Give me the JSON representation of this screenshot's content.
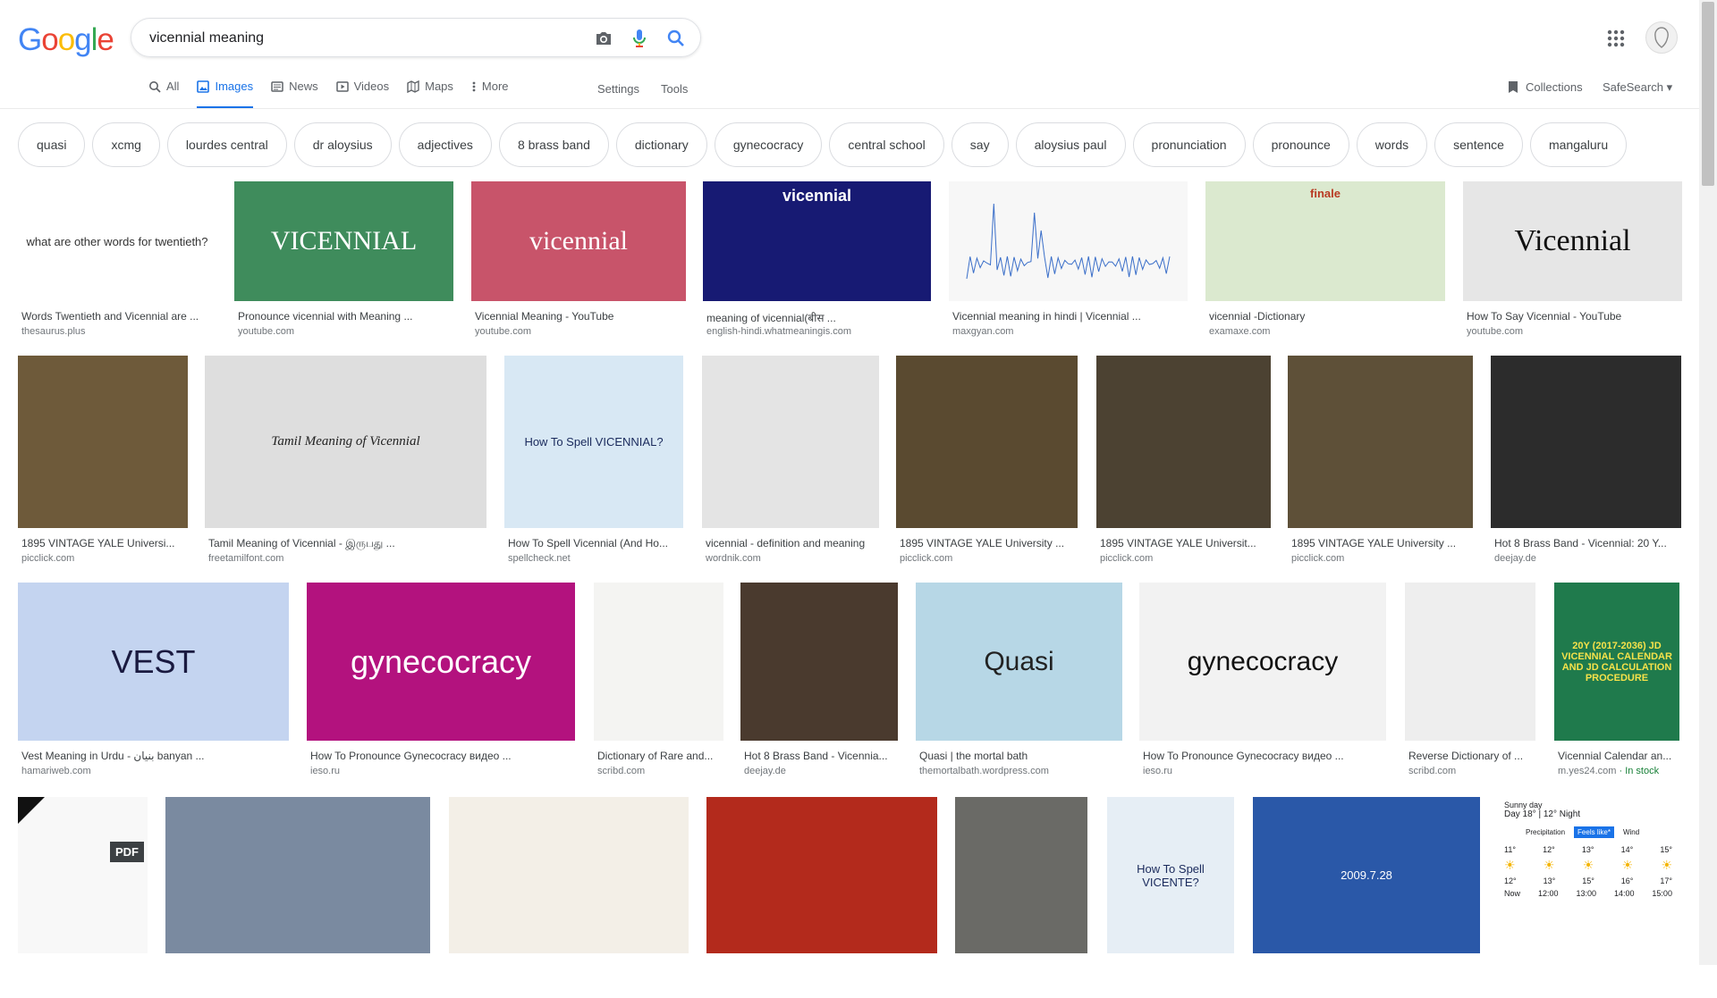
{
  "header": {
    "logo": "Google",
    "search_value": "vicennial meaning"
  },
  "tabs": [
    {
      "label": "All",
      "icon": "search-icon"
    },
    {
      "label": "Images",
      "icon": "image-icon",
      "active": true
    },
    {
      "label": "News",
      "icon": "news-icon"
    },
    {
      "label": "Videos",
      "icon": "video-icon"
    },
    {
      "label": "Maps",
      "icon": "map-icon"
    },
    {
      "label": "More",
      "icon": "more-vert-icon"
    }
  ],
  "settings_label": "Settings",
  "tools_label": "Tools",
  "collections_label": "Collections",
  "safesearch_label": "SafeSearch",
  "chips": [
    "quasi",
    "xcmg",
    "lourdes central",
    "dr aloysius",
    "adjectives",
    "8 brass band",
    "dictionary",
    "gynecocracy",
    "central school",
    "say",
    "aloysius paul",
    "pronunciation",
    "pronounce",
    "words",
    "sentence",
    "mangaluru"
  ],
  "results": [
    {
      "title": "Words Twentieth and Vicennial are ...",
      "source": "thesaurus.plus",
      "thumb_text": "what are other words for twentieth?",
      "bg": "#ffffff",
      "fg": "#333333"
    },
    {
      "title": "Pronounce vicennial with Meaning ...",
      "source": "youtube.com",
      "thumb_text": "VICENNIAL",
      "bg": "#3f8c5c",
      "fg": "#ffffff"
    },
    {
      "title": "Vicennial Meaning - YouTube",
      "source": "youtube.com",
      "thumb_text": "vicennial",
      "bg": "#c8546a",
      "fg": "#ffffff"
    },
    {
      "title": "meaning of vicennial(बीस ...",
      "source": "english-hindi.whatmeaningis.com",
      "thumb_text": "vicennial",
      "bg": "#171a73",
      "fg": "#ffffff"
    },
    {
      "title": "Vicennial meaning in hindi | Vicennial ...",
      "source": "maxgyan.com",
      "thumb_text": "",
      "bg": "#f7f7f7",
      "fg": "#3b6fc9"
    },
    {
      "title": "vicennial -Dictionary",
      "source": "examaxe.com",
      "thumb_text": "finale",
      "bg": "#dbe9cf",
      "fg": "#b83a22"
    },
    {
      "title": "How To Say Vicennial - YouTube",
      "source": "youtube.com",
      "thumb_text": "Vicennial",
      "bg": "#e6e6e6",
      "fg": "#111111"
    },
    {
      "title": "1895 VINTAGE YALE Universi...",
      "source": "picclick.com",
      "thumb_text": "",
      "bg": "#6e5a3a",
      "fg": "#e8e2c8"
    },
    {
      "title": "Tamil Meaning of Vicennial - இருபது ...",
      "source": "freetamilfont.com",
      "thumb_text": "Tamil Meaning of Vicennial",
      "bg": "#dedede",
      "fg": "#222222"
    },
    {
      "title": "How To Spell Vicennial (And Ho...",
      "source": "spellcheck.net",
      "thumb_text": "How To Spell VICENNIAL?",
      "bg": "#d8e8f4",
      "fg": "#1a2a5c"
    },
    {
      "title": "vicennial - definition and meaning",
      "source": "wordnik.com",
      "thumb_text": "",
      "bg": "#e4e4e4",
      "fg": "#444444"
    },
    {
      "title": "1895 VINTAGE YALE University ...",
      "source": "picclick.com",
      "thumb_text": "",
      "bg": "#5a4a30",
      "fg": "#e8e2c8"
    },
    {
      "title": "1895 VINTAGE YALE Universit...",
      "source": "picclick.com",
      "thumb_text": "",
      "bg": "#4c4232",
      "fg": "#e0dccc"
    },
    {
      "title": "1895 VINTAGE YALE University ...",
      "source": "picclick.com",
      "thumb_text": "",
      "bg": "#5e5038",
      "fg": "#e8e2c8"
    },
    {
      "title": "Hot 8 Brass Band - Vicennial: 20 Y...",
      "source": "deejay.de",
      "thumb_text": "",
      "bg": "#2c2c2c",
      "fg": "#c0392b"
    },
    {
      "title": "Vest Meaning in Urdu - بنیان banyan ...",
      "source": "hamariweb.com",
      "thumb_text": "VEST",
      "bg": "#c4d4f0",
      "fg": "#1a1a40"
    },
    {
      "title": "How To Pronounce Gynecocracy видео ...",
      "source": "ieso.ru",
      "thumb_text": "gynecocracy",
      "bg": "#b3127e",
      "fg": "#ffffff"
    },
    {
      "title": "Dictionary of Rare and...",
      "source": "scribd.com",
      "thumb_text": "",
      "bg": "#f4f4f2",
      "fg": "#555555"
    },
    {
      "title": "Hot 8 Brass Band - Vicennia...",
      "source": "deejay.de",
      "thumb_text": "",
      "bg": "#4a3a2e",
      "fg": "#9a8060"
    },
    {
      "title": "Quasi | the mortal bath",
      "source": "themortalbath.wordpress.com",
      "thumb_text": "Quasi",
      "bg": "#b7d7e6",
      "fg": "#222222"
    },
    {
      "title": "How To Pronounce Gynecocracy видео ...",
      "source": "ieso.ru",
      "thumb_text": "gynecocracy",
      "bg": "#f2f2f2",
      "fg": "#111111"
    },
    {
      "title": "Reverse Dictionary of ...",
      "source": "scribd.com",
      "thumb_text": "",
      "bg": "#eeeeee",
      "fg": "#1f4f8f"
    },
    {
      "title": "Vicennial Calendar an...",
      "source": "m.yes24.com",
      "stock": " · In stock",
      "thumb_text": "20Y (2017-2036) JD VICENNIAL CALENDAR AND JD CALCULATION PROCEDURE",
      "bg": "#1f7a4c",
      "fg": "#f6e24a"
    },
    {
      "title": "",
      "source": "",
      "thumb_text": "PDF",
      "bg": "#f8f8f8",
      "fg": "#ffffff"
    },
    {
      "title": "",
      "source": "",
      "thumb_text": "",
      "bg": "#7a8aa0",
      "fg": "#ffffff"
    },
    {
      "title": "",
      "source": "",
      "thumb_text": "",
      "bg": "#f3efe7",
      "fg": "#222222"
    },
    {
      "title": "",
      "source": "",
      "thumb_text": "",
      "bg": "#b32a1c",
      "fg": "#ffd54a"
    },
    {
      "title": "",
      "source": "",
      "thumb_text": "",
      "bg": "#6a6a66",
      "fg": "#e8e8e0"
    },
    {
      "title": "",
      "source": "",
      "thumb_text": "How To Spell VICENTE?",
      "bg": "#e6eef5",
      "fg": "#1a2a5c"
    },
    {
      "title": "",
      "source": "",
      "thumb_text": "2009.7.28",
      "bg": "#2a58a8",
      "fg": "#ffffff"
    },
    {
      "title": "",
      "source": "",
      "thumb_text": "Sunny day",
      "bg": "#ffffff",
      "fg": "#202124"
    }
  ],
  "weather_widget": {
    "day_label": "Day",
    "day_temp": "18°",
    "night_temp": "12°",
    "night_label": "Night",
    "tabs": [
      "Precipitation",
      "Feels like*",
      "Wind"
    ],
    "hours": [
      "11°",
      "12°",
      "13°",
      "14°",
      "15°"
    ],
    "lows": [
      "12°",
      "13°",
      "15°",
      "16°",
      "17°"
    ],
    "times": [
      "Now",
      "12:00",
      "13:00",
      "14:00",
      "15:00"
    ]
  }
}
